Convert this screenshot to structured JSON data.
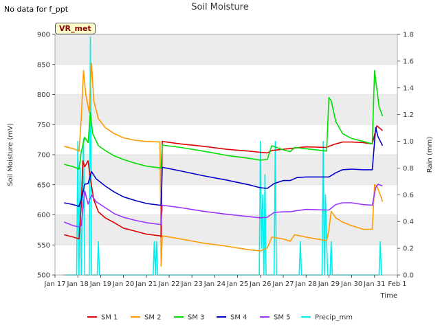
{
  "header": {
    "nodata_text": "No data for f_ppt",
    "title": "Soil Moisture",
    "badge": "VR_met"
  },
  "chart_data": {
    "type": "line",
    "title": "Soil Moisture",
    "xlabel": "Time",
    "ylabel": "Soil Moisture (mV)",
    "y2label": "Rain (mm)",
    "xlim": [
      17,
      32
    ],
    "ylim": [
      500,
      900
    ],
    "y2lim": [
      0,
      1.8
    ],
    "x_ticks": [
      17,
      18,
      19,
      20,
      21,
      22,
      23,
      24,
      25,
      26,
      27,
      28,
      29,
      30,
      31,
      32
    ],
    "x_tick_labels": [
      "Jan 17",
      "Jan 18",
      "Jan 19",
      "Jan 20",
      "Jan 21",
      "Jan 22",
      "Jan 23",
      "Jan 24",
      "Jan 25",
      "Jan 26",
      "Jan 27",
      "Jan 28",
      "Jan 29",
      "Jan 30",
      "Jan 31",
      "Feb 1"
    ],
    "y_ticks": [
      500,
      550,
      600,
      650,
      700,
      750,
      800,
      850,
      900
    ],
    "y2_ticks": [
      0.0,
      0.2,
      0.4,
      0.6,
      0.8,
      1.0,
      1.2,
      1.4,
      1.6,
      1.8
    ],
    "grid": "horizontal bands",
    "legend_position": "bottom-center",
    "series": [
      {
        "name": "SM 1",
        "color": "#dd0000",
        "axis": "left",
        "points": [
          [
            17.4,
            567
          ],
          [
            17.8,
            563
          ],
          [
            18.05,
            560
          ],
          [
            18.15,
            615
          ],
          [
            18.22,
            690
          ],
          [
            18.3,
            680
          ],
          [
            18.45,
            690
          ],
          [
            18.55,
            660
          ],
          [
            18.7,
            625
          ],
          [
            18.9,
            605
          ],
          [
            19.2,
            595
          ],
          [
            19.6,
            587
          ],
          [
            20.0,
            578
          ],
          [
            20.5,
            573
          ],
          [
            21.0,
            568
          ],
          [
            21.6,
            565
          ],
          [
            21.65,
            564
          ],
          [
            21.7,
            722
          ],
          [
            22.5,
            718
          ],
          [
            23.5,
            714
          ],
          [
            24.5,
            709
          ],
          [
            25.5,
            706
          ],
          [
            26.0,
            704
          ],
          [
            26.3,
            703
          ],
          [
            26.5,
            707
          ],
          [
            27.0,
            709
          ],
          [
            28.0,
            713
          ],
          [
            28.9,
            712
          ],
          [
            29.0,
            714
          ],
          [
            29.3,
            718
          ],
          [
            29.6,
            721
          ],
          [
            30.0,
            721
          ],
          [
            30.5,
            720
          ],
          [
            30.9,
            718
          ],
          [
            31.1,
            748
          ],
          [
            31.2,
            745
          ],
          [
            31.35,
            740
          ]
        ]
      },
      {
        "name": "SM 2",
        "color": "#ff9900",
        "axis": "left",
        "points": [
          [
            17.4,
            714
          ],
          [
            17.8,
            710
          ],
          [
            18.05,
            706
          ],
          [
            18.15,
            760
          ],
          [
            18.25,
            840
          ],
          [
            18.35,
            800
          ],
          [
            18.5,
            770
          ],
          [
            18.6,
            852
          ],
          [
            18.7,
            790
          ],
          [
            18.9,
            760
          ],
          [
            19.2,
            745
          ],
          [
            19.6,
            735
          ],
          [
            20.0,
            728
          ],
          [
            20.5,
            724
          ],
          [
            21.0,
            722
          ],
          [
            21.6,
            721
          ],
          [
            21.65,
            515
          ],
          [
            21.7,
            565
          ],
          [
            22.5,
            560
          ],
          [
            23.5,
            553
          ],
          [
            24.5,
            548
          ],
          [
            25.5,
            542
          ],
          [
            26.0,
            540
          ],
          [
            26.3,
            545
          ],
          [
            26.5,
            563
          ],
          [
            27.0,
            560
          ],
          [
            27.3,
            556
          ],
          [
            27.5,
            567
          ],
          [
            28.0,
            563
          ],
          [
            28.9,
            557
          ],
          [
            29.0,
            575
          ],
          [
            29.1,
            606
          ],
          [
            29.3,
            595
          ],
          [
            29.6,
            588
          ],
          [
            30.0,
            582
          ],
          [
            30.5,
            576
          ],
          [
            30.9,
            576
          ],
          [
            31.0,
            650
          ],
          [
            31.1,
            648
          ],
          [
            31.3,
            628
          ],
          [
            31.35,
            622
          ]
        ]
      },
      {
        "name": "SM 3",
        "color": "#00dd00",
        "axis": "left",
        "points": [
          [
            17.4,
            684
          ],
          [
            17.8,
            680
          ],
          [
            18.05,
            676
          ],
          [
            18.15,
            705
          ],
          [
            18.3,
            729
          ],
          [
            18.45,
            720
          ],
          [
            18.55,
            770
          ],
          [
            18.65,
            735
          ],
          [
            18.9,
            715
          ],
          [
            19.2,
            707
          ],
          [
            19.6,
            698
          ],
          [
            20.0,
            692
          ],
          [
            20.5,
            686
          ],
          [
            21.0,
            681
          ],
          [
            21.6,
            678
          ],
          [
            21.65,
            678
          ],
          [
            21.7,
            716
          ],
          [
            22.5,
            712
          ],
          [
            23.5,
            706
          ],
          [
            24.5,
            699
          ],
          [
            25.5,
            694
          ],
          [
            26.0,
            691
          ],
          [
            26.3,
            692
          ],
          [
            26.5,
            715
          ],
          [
            27.0,
            708
          ],
          [
            27.3,
            705
          ],
          [
            27.5,
            712
          ],
          [
            28.0,
            710
          ],
          [
            28.9,
            706
          ],
          [
            29.0,
            795
          ],
          [
            29.1,
            790
          ],
          [
            29.3,
            755
          ],
          [
            29.6,
            735
          ],
          [
            30.0,
            727
          ],
          [
            30.5,
            722
          ],
          [
            30.9,
            718
          ],
          [
            31.0,
            840
          ],
          [
            31.1,
            810
          ],
          [
            31.2,
            780
          ],
          [
            31.35,
            764
          ]
        ]
      },
      {
        "name": "SM 4",
        "color": "#0000cc",
        "axis": "left",
        "points": [
          [
            17.4,
            620
          ],
          [
            17.8,
            617
          ],
          [
            18.05,
            614
          ],
          [
            18.15,
            625
          ],
          [
            18.3,
            651
          ],
          [
            18.45,
            652
          ],
          [
            18.6,
            672
          ],
          [
            18.8,
            660
          ],
          [
            19.2,
            648
          ],
          [
            19.6,
            638
          ],
          [
            20.0,
            630
          ],
          [
            20.5,
            624
          ],
          [
            21.0,
            619
          ],
          [
            21.6,
            616
          ],
          [
            21.65,
            616
          ],
          [
            21.7,
            679
          ],
          [
            22.5,
            673
          ],
          [
            23.5,
            665
          ],
          [
            24.5,
            658
          ],
          [
            25.5,
            650
          ],
          [
            26.0,
            645
          ],
          [
            26.3,
            644
          ],
          [
            26.6,
            652
          ],
          [
            27.0,
            657
          ],
          [
            27.3,
            657
          ],
          [
            27.6,
            662
          ],
          [
            28.0,
            663
          ],
          [
            28.9,
            663
          ],
          [
            29.0,
            663
          ],
          [
            29.3,
            670
          ],
          [
            29.6,
            675
          ],
          [
            30.0,
            676
          ],
          [
            30.5,
            675
          ],
          [
            30.9,
            675
          ],
          [
            31.05,
            745
          ],
          [
            31.15,
            730
          ],
          [
            31.35,
            715
          ]
        ]
      },
      {
        "name": "SM 5",
        "color": "#9933ff",
        "axis": "left",
        "points": [
          [
            17.4,
            588
          ],
          [
            17.8,
            582
          ],
          [
            18.05,
            580
          ],
          [
            18.15,
            582
          ],
          [
            18.3,
            640
          ],
          [
            18.45,
            618
          ],
          [
            18.6,
            633
          ],
          [
            18.8,
            622
          ],
          [
            19.2,
            612
          ],
          [
            19.6,
            602
          ],
          [
            20.0,
            596
          ],
          [
            20.5,
            591
          ],
          [
            21.0,
            587
          ],
          [
            21.6,
            584
          ],
          [
            21.65,
            584
          ],
          [
            21.7,
            616
          ],
          [
            22.5,
            612
          ],
          [
            23.5,
            606
          ],
          [
            24.5,
            601
          ],
          [
            25.5,
            597
          ],
          [
            26.0,
            595
          ],
          [
            26.3,
            596
          ],
          [
            26.6,
            604
          ],
          [
            27.0,
            605
          ],
          [
            27.3,
            605
          ],
          [
            27.6,
            607
          ],
          [
            28.0,
            609
          ],
          [
            28.9,
            608
          ],
          [
            29.0,
            608
          ],
          [
            29.3,
            617
          ],
          [
            29.6,
            620
          ],
          [
            30.0,
            620
          ],
          [
            30.5,
            617
          ],
          [
            30.9,
            616
          ],
          [
            31.05,
            645
          ],
          [
            31.15,
            651
          ],
          [
            31.35,
            648
          ]
        ]
      },
      {
        "name": "Precip_mm",
        "color": "#00eeee",
        "axis": "right",
        "points": [
          [
            17.4,
            0
          ],
          [
            17.95,
            0
          ],
          [
            18.0,
            1.0
          ],
          [
            18.05,
            0
          ],
          [
            18.1,
            0.8
          ],
          [
            18.15,
            0
          ],
          [
            18.25,
            1.02
          ],
          [
            18.3,
            0
          ],
          [
            18.5,
            0
          ],
          [
            18.55,
            1.78
          ],
          [
            18.6,
            0
          ],
          [
            18.85,
            0
          ],
          [
            18.9,
            0.25
          ],
          [
            18.95,
            0
          ],
          [
            21.3,
            0
          ],
          [
            21.35,
            0.25
          ],
          [
            21.4,
            0
          ],
          [
            21.45,
            0.25
          ],
          [
            21.5,
            0
          ],
          [
            25.95,
            0
          ],
          [
            26.0,
            1.0
          ],
          [
            26.05,
            0.2
          ],
          [
            26.1,
            0.6
          ],
          [
            26.15,
            0
          ],
          [
            26.2,
            0.75
          ],
          [
            26.25,
            0
          ],
          [
            26.6,
            0
          ],
          [
            26.65,
            1.0
          ],
          [
            26.7,
            0
          ],
          [
            27.7,
            0
          ],
          [
            27.75,
            0.25
          ],
          [
            27.8,
            0
          ],
          [
            28.7,
            0
          ],
          [
            28.75,
            1.0
          ],
          [
            28.8,
            0
          ],
          [
            28.85,
            0.6
          ],
          [
            28.9,
            0.25
          ],
          [
            28.95,
            0
          ],
          [
            29.05,
            0
          ],
          [
            29.1,
            0.25
          ],
          [
            29.15,
            0
          ],
          [
            31.2,
            0
          ],
          [
            31.25,
            0.25
          ],
          [
            31.3,
            0
          ],
          [
            31.35,
            0
          ]
        ]
      }
    ]
  }
}
